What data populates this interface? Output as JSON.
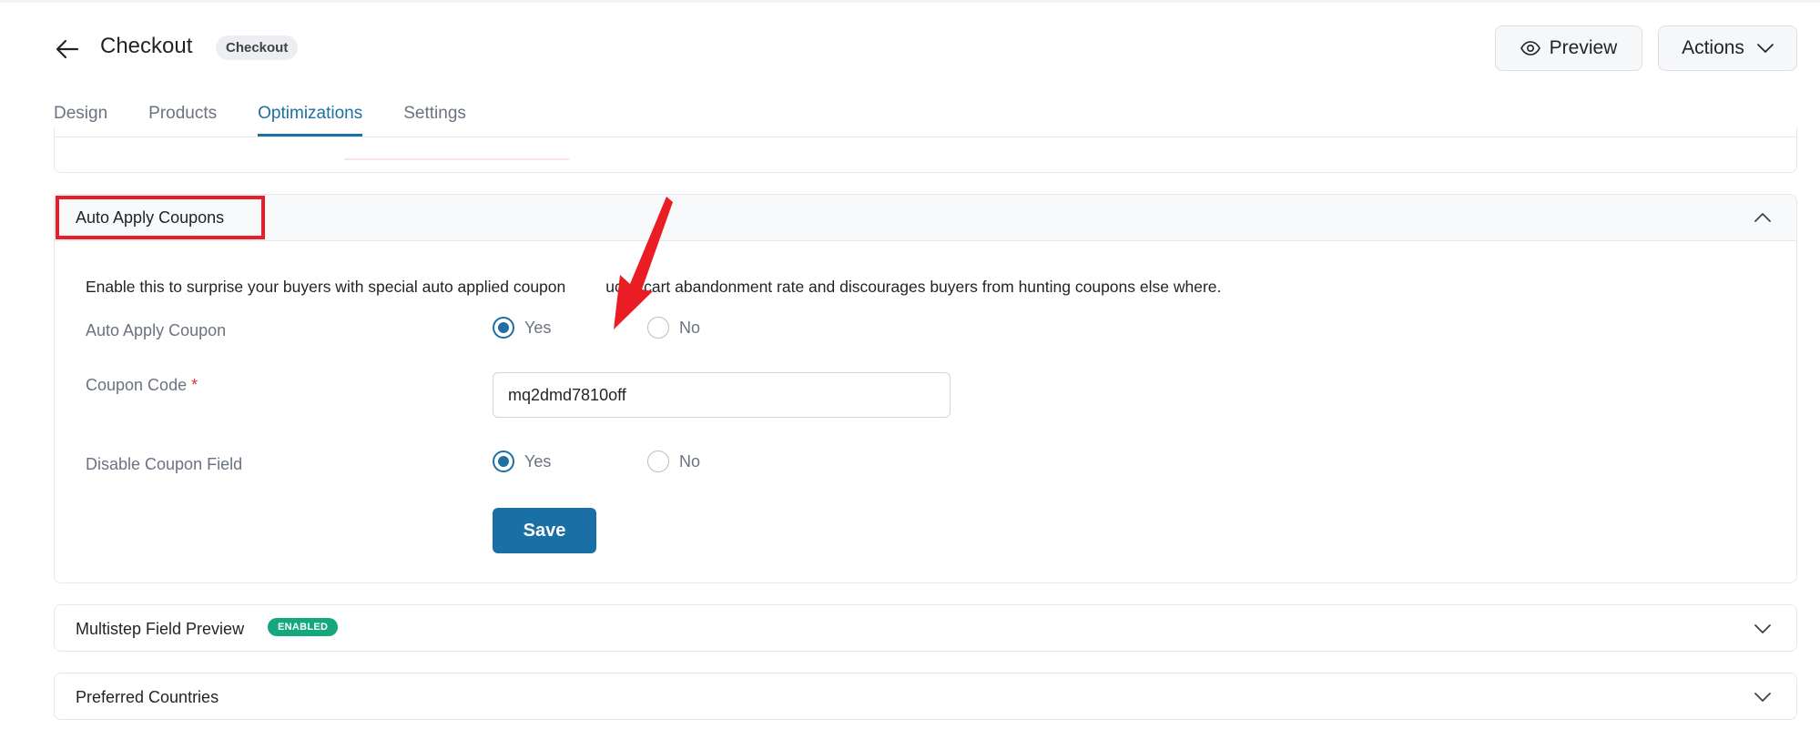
{
  "header": {
    "title": "Checkout",
    "badge": "Checkout",
    "preview_label": "Preview",
    "actions_label": "Actions"
  },
  "tabs": [
    {
      "label": "Design",
      "active": false
    },
    {
      "label": "Products",
      "active": false
    },
    {
      "label": "Optimizations",
      "active": true
    },
    {
      "label": "Settings",
      "active": false
    }
  ],
  "auto_apply": {
    "title": "Auto Apply Coupons",
    "description": "Enable this to surprise your buyers with special auto applied coupon. Reduces cart abandonment rate and discourages buyers from hunting coupons else where.",
    "description_visible_start": "Enable this to surprise your buyers with special auto applied coupon",
    "description_visible_end": "uces cart abandonment rate and discourages buyers from hunting coupons else where.",
    "auto_apply_label": "Auto Apply Coupon",
    "auto_apply_value": "Yes",
    "coupon_code_label": "Coupon Code",
    "required_mark": "*",
    "coupon_code_value": "mq2dmd7810off",
    "disable_field_label": "Disable Coupon Field",
    "disable_field_value": "Yes",
    "yes_label": "Yes",
    "no_label": "No",
    "save_label": "Save"
  },
  "multistep": {
    "title": "Multistep Field Preview",
    "badge": "ENABLED"
  },
  "preferred": {
    "title": "Preferred Countries"
  },
  "colors": {
    "accent": "#1e6fa3",
    "save_button": "#1a6fa6",
    "badge_enabled": "#15a87e",
    "annotation_red": "#ea1d25"
  }
}
